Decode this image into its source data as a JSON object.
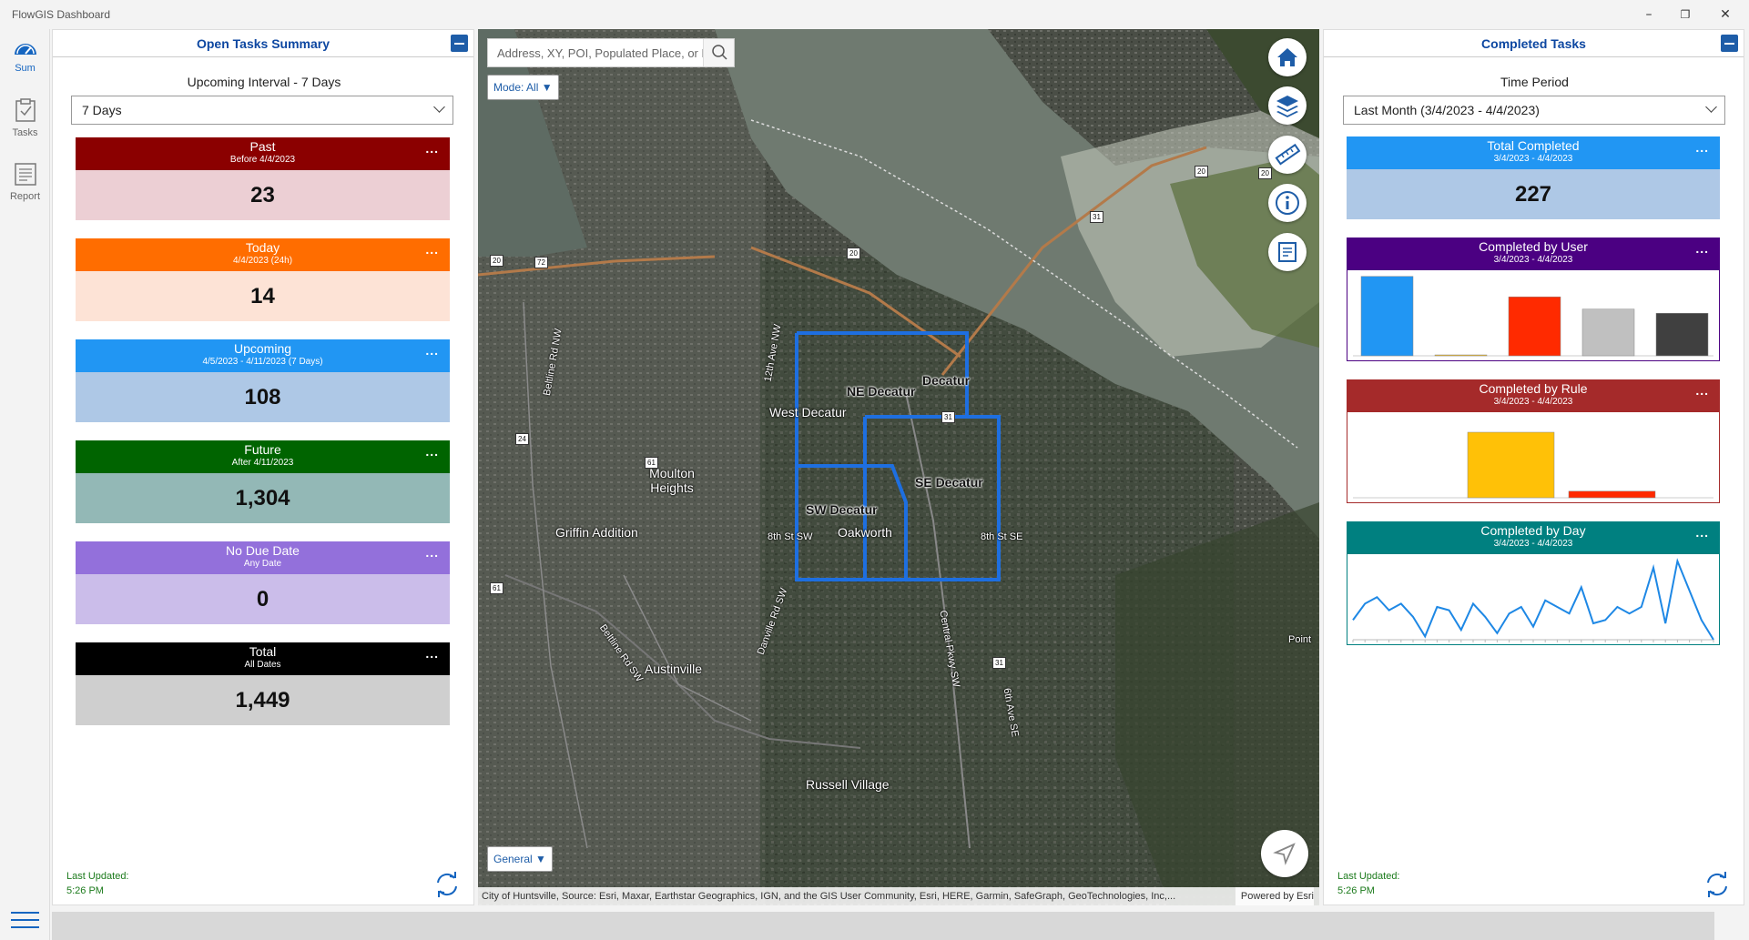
{
  "app": {
    "title": "FlowGIS Dashboard"
  },
  "nav": {
    "items": [
      {
        "label": "Sum"
      },
      {
        "label": "Tasks"
      },
      {
        "label": "Report"
      }
    ]
  },
  "open_tasks": {
    "header": "Open Tasks Summary",
    "interval_label": "Upcoming Interval - 7 Days",
    "interval_value": "7 Days",
    "cards": [
      {
        "title": "Past",
        "subtitle": "Before 4/4/2023",
        "value": "23",
        "head_color": "#8b0000",
        "body_color": "#eccfd4"
      },
      {
        "title": "Today",
        "subtitle": "4/4/2023 (24h)",
        "value": "14",
        "head_color": "#ff6d00",
        "body_color": "#fde3d6"
      },
      {
        "title": "Upcoming",
        "subtitle": "4/5/2023 - 4/11/2023 (7 Days)",
        "value": "108",
        "head_color": "#2196f3",
        "body_color": "#aec8e6"
      },
      {
        "title": "Future",
        "subtitle": "After 4/11/2023",
        "value": "1,304",
        "head_color": "#006400",
        "body_color": "#93b8b6"
      },
      {
        "title": "No Due Date",
        "subtitle": "Any Date",
        "value": "0",
        "head_color": "#9370db",
        "body_color": "#cbbdea"
      },
      {
        "title": "Total",
        "subtitle": "All Dates",
        "value": "1,449",
        "head_color": "#000000",
        "body_color": "#cfcfcf"
      }
    ],
    "more_label": "...",
    "last_updated_label": "Last Updated:",
    "last_updated_time": "5:26 PM"
  },
  "map": {
    "search_placeholder": "Address, XY, POI, Populated Place, or Postal",
    "mode_label": "Mode: All",
    "basemap_label": "General",
    "attribution": "City of Huntsville, Source: Esri, Maxar, Earthstar Geographics, IGN, and the GIS User Community, Esri, HERE, Garmin, SafeGraph, GeoTechnologies, Inc,...",
    "powered_by": "Powered by Esri",
    "labels": [
      {
        "text": "Decatur",
        "style": "dark"
      },
      {
        "text": "NE Decatur",
        "style": "dark"
      },
      {
        "text": "West Decatur",
        "style": ""
      },
      {
        "text": "SE Decatur",
        "style": "dark"
      },
      {
        "text": "SW Decatur",
        "style": "dark"
      },
      {
        "text": "Oakworth",
        "style": ""
      },
      {
        "text": "Moulton Heights",
        "style": ""
      },
      {
        "text": "Griffin Addition",
        "style": ""
      },
      {
        "text": "Austinville",
        "style": ""
      },
      {
        "text": "Russell Village",
        "style": ""
      },
      {
        "text": "8th St SW",
        "style": "small"
      },
      {
        "text": "8th St SE",
        "style": "small"
      },
      {
        "text": "12th Ave NW",
        "style": "small"
      },
      {
        "text": "Beltline Rd NW",
        "style": "small"
      },
      {
        "text": "Beltline Rd SW",
        "style": "small"
      },
      {
        "text": "Danville Rd SW",
        "style": "small"
      },
      {
        "text": "Central Pkwy SW",
        "style": "small"
      },
      {
        "text": "6th Ave SE",
        "style": "small"
      },
      {
        "text": "Point",
        "style": "small"
      }
    ],
    "shields": [
      "20",
      "72",
      "24",
      "61",
      "20",
      "31",
      "61",
      "31",
      "31",
      "20",
      "20"
    ]
  },
  "completed_tasks": {
    "header": "Completed Tasks",
    "period_label": "Time Period",
    "period_value": "Last Month (3/4/2023 - 4/4/2023)",
    "total": {
      "title": "Total Completed",
      "subtitle": "3/4/2023 - 4/4/2023",
      "value": "227",
      "head_color": "#2196f3",
      "body_color": "#aec8e6"
    },
    "by_user": {
      "title": "Completed by User",
      "subtitle": "3/4/2023 - 4/4/2023",
      "head_color": "#4b0082"
    },
    "by_rule": {
      "title": "Completed by Rule",
      "subtitle": "3/4/2023 - 4/4/2023",
      "head_color": "#a52a2a"
    },
    "by_day": {
      "title": "Completed by Day",
      "subtitle": "3/4/2023 - 4/4/2023",
      "head_color": "#008080"
    },
    "last_updated_label": "Last Updated:",
    "last_updated_time": "5:26 PM"
  },
  "chart_data": [
    {
      "type": "bar",
      "categories": [
        "1",
        "2",
        "3",
        "4",
        "5"
      ],
      "values": [
        97,
        1,
        72,
        57,
        52
      ],
      "colors": [
        "#2196f3",
        "#ffc107",
        "#ff2a00",
        "#c0c0c0",
        "#404040"
      ],
      "ylim": [
        0,
        100
      ]
    },
    {
      "type": "bar",
      "categories": [
        "1",
        "2",
        "3"
      ],
      "values": [
        0,
        80,
        8
      ],
      "colors": [
        "#2196f3",
        "#ffc107",
        "#ff2a00"
      ],
      "ylim": [
        0,
        100
      ]
    },
    {
      "type": "line",
      "values": [
        6,
        11,
        13,
        9,
        11,
        7,
        1,
        10,
        9,
        3,
        11,
        7,
        2,
        8,
        10,
        4,
        12,
        10,
        8,
        16,
        5,
        6,
        10,
        8,
        10,
        22,
        5,
        24,
        15,
        6,
        0
      ],
      "color": "#1e88e5",
      "ylim": [
        0,
        25
      ]
    }
  ]
}
